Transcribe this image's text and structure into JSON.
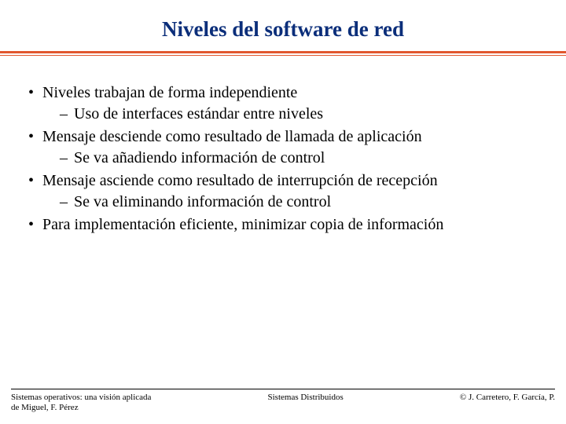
{
  "title": "Niveles del software de red",
  "bullets": {
    "b1": "Niveles trabajan de forma independiente",
    "b1s1": "Uso de interfaces estándar entre niveles",
    "b2": "Mensaje desciende como resultado de llamada de aplicación",
    "b2s1": "Se va añadiendo información de control",
    "b3": "Mensaje asciende como resultado de interrupción de recepción",
    "b3s1": "Se va eliminando información de control",
    "b4": "Para implementación eficiente, minimizar copia de información"
  },
  "footer": {
    "left_line1": "Sistemas operativos: una visión aplicada",
    "left_line2": "de Miguel, F. Pérez",
    "center": "Sistemas Distribuidos",
    "right": "© J. Carretero, F. García, P."
  }
}
